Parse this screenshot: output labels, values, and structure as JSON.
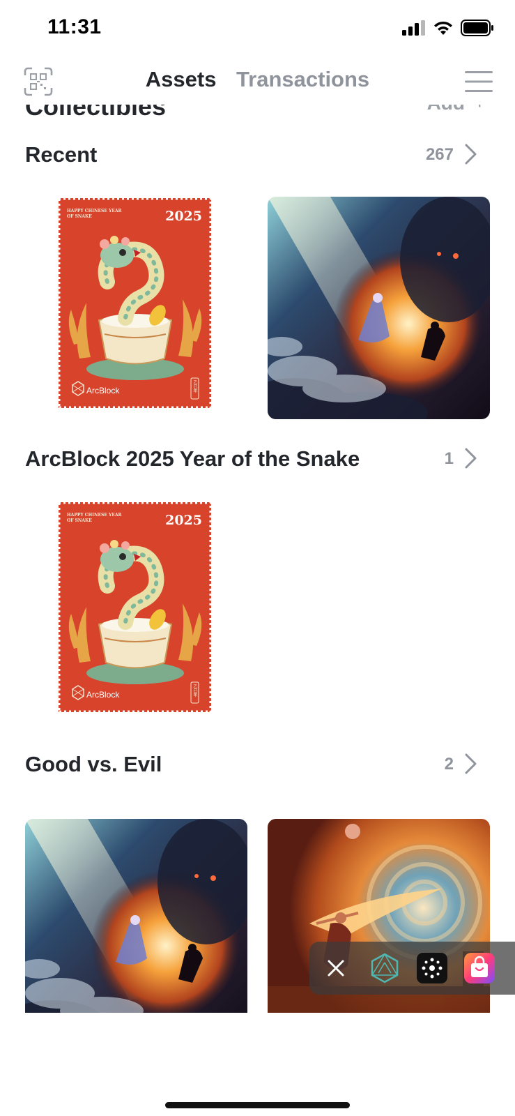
{
  "status_bar": {
    "time": "11:31"
  },
  "header": {
    "tabs": [
      {
        "label": "Assets",
        "active": true
      },
      {
        "label": "Transactions",
        "active": false
      }
    ]
  },
  "partial_heading": {
    "title": "Collectibles",
    "add_label": "Add",
    "plus": "+"
  },
  "sections": [
    {
      "title": "Recent",
      "count": "267"
    },
    {
      "title": "ArcBlock 2025 Year of the Snake",
      "count": "1"
    },
    {
      "title": "Good vs. Evil",
      "count": "2"
    }
  ],
  "stamp": {
    "year": "2025",
    "caption_line1": "HAPPY CHINESE YEAR",
    "caption_line2": "OF SNAKE",
    "brand": "ArcBlock",
    "seal": "乙巳年"
  },
  "floating_bar": {
    "icons": [
      "close-icon",
      "arcblock-logo-icon",
      "dots-app-icon",
      "shopping-bag-icon"
    ]
  },
  "colors": {
    "stamp_red": "#d8432c",
    "text": "#23262b",
    "muted": "#8f949c"
  }
}
